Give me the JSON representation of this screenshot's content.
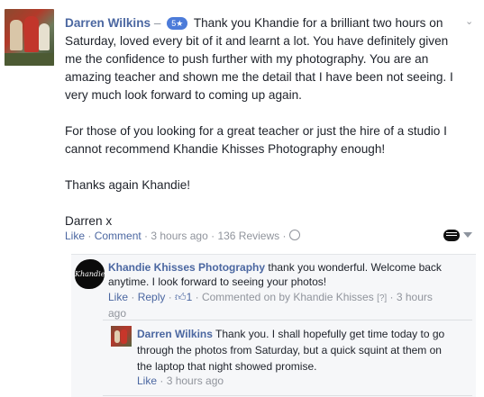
{
  "post": {
    "author": "Darren Wilkins",
    "dash": "–",
    "rating_badge": "5★",
    "paragraphs": [
      "Thank you Khandie for a brilliant two hours on Saturday, loved every bit of it and learnt a lot. You have definitely given me the confidence to push further with my photography. You are an amazing teacher and shown me the detail that I have been not seeing. I very much look forward to coming up again.",
      "For those of you looking for a great teacher or just the hire of a studio I cannot recommend Khandie Khisses Photography enough!",
      "Thanks again Khandie!",
      "Darren x"
    ],
    "actions": {
      "like": "Like",
      "comment": "Comment",
      "time": "3 hours ago",
      "reviews": "136 Reviews",
      "sep": " · "
    }
  },
  "reply1": {
    "logo_text": "Khandie",
    "author": "Khandie Khisses Photography",
    "text": "thank you wonderful. Welcome back anytime. I look forward to seeing your photos!",
    "like": "Like",
    "reply": "Reply",
    "like_count": "1",
    "commented_on_by": "Commented on by Khandie Khisses",
    "help": "[?]",
    "time": "3 hours ago"
  },
  "reply2": {
    "author": "Darren Wilkins",
    "text": "Thank you. I shall hopefully get time today to go through the photos from Saturday, but a quick squint at them on the laptop that night showed promise.",
    "like": "Like",
    "time": "3 hours ago"
  },
  "colors": {
    "link": "#4b67a1",
    "meta": "#90949c",
    "badge": "#4c7bd9",
    "thread_bg": "#f6f7f9"
  }
}
